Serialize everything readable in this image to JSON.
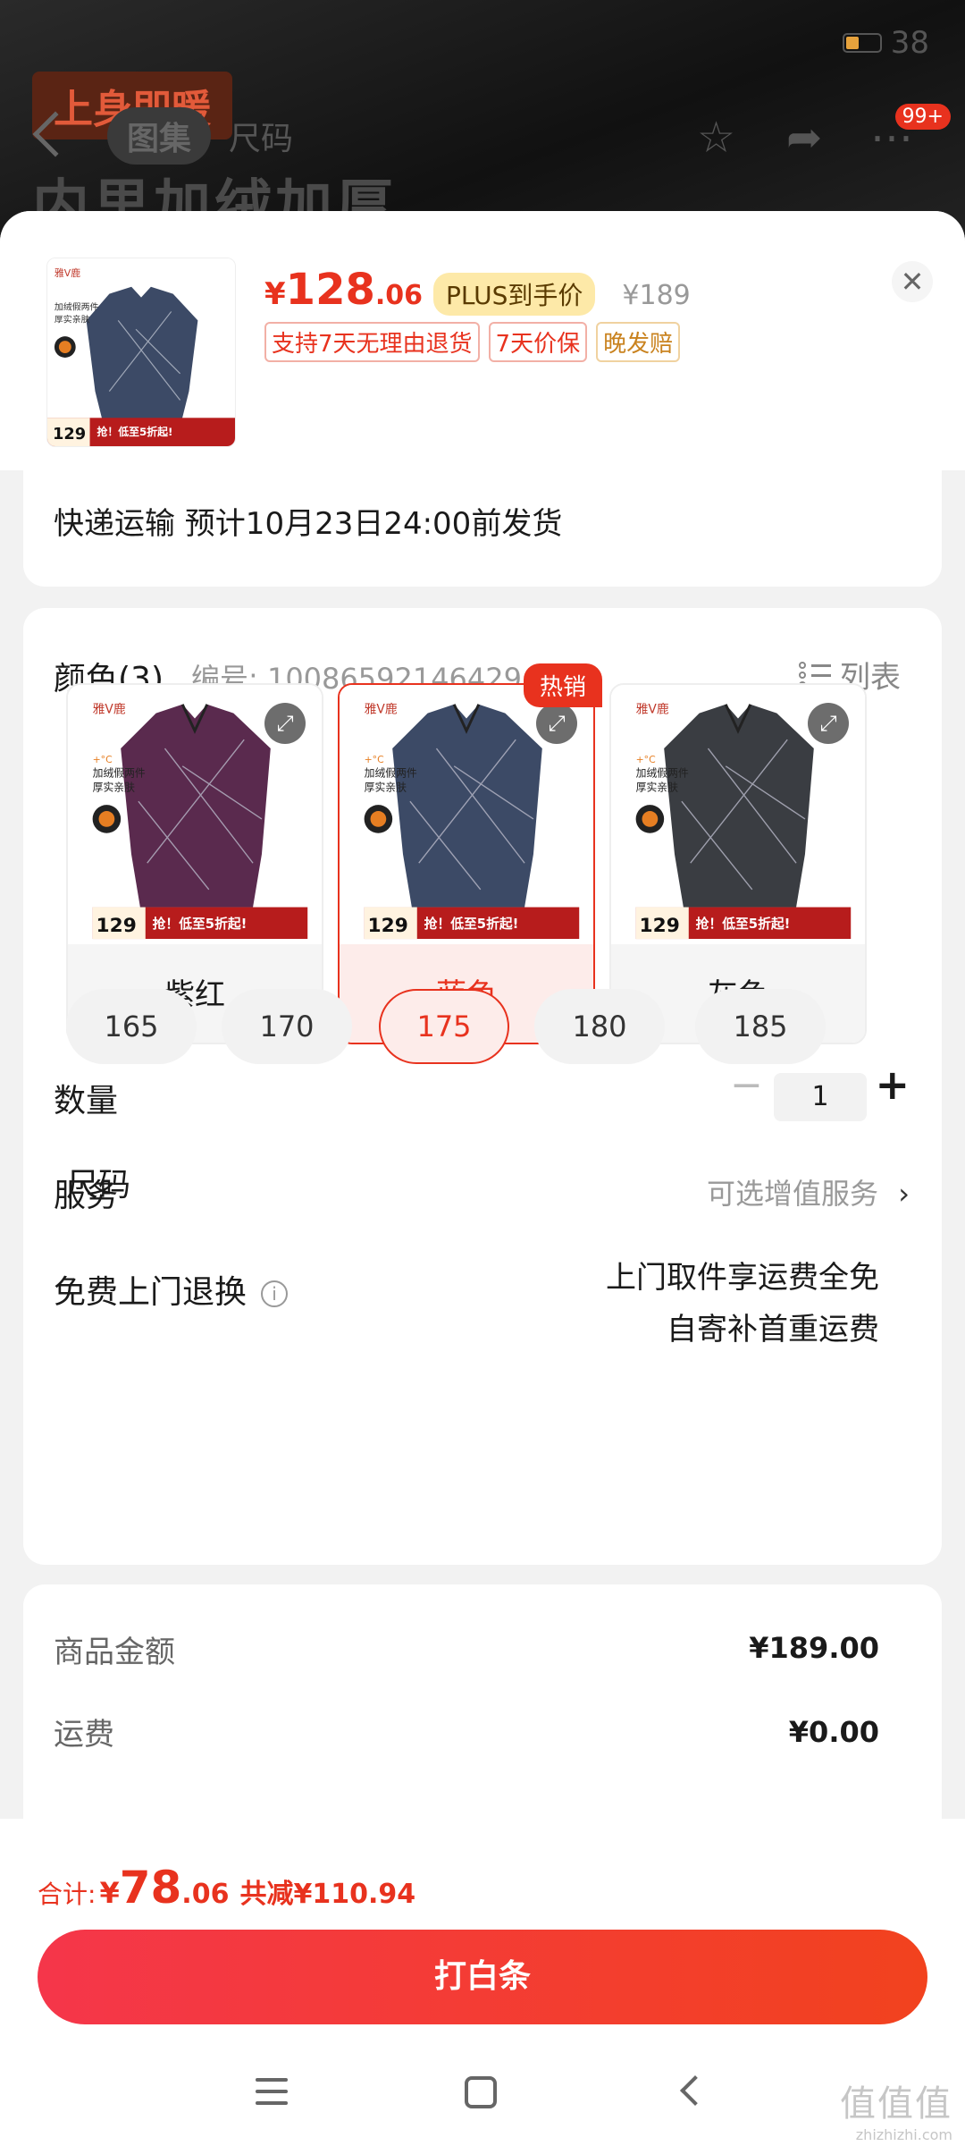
{
  "background": {
    "promo_text": "上身即暖",
    "headline": "内里加绒加厚",
    "status_battery": "38",
    "tabs": [
      {
        "label": "图集"
      },
      {
        "label": "尺码"
      }
    ],
    "cart_badge": "99+"
  },
  "header": {
    "price_symbol": "¥",
    "price_int": "128",
    "price_dec": ".06",
    "plus_tag": "PLUS到手价",
    "original_price": "¥189",
    "tags": [
      {
        "label": "支持7天无理由退货"
      },
      {
        "label": "7天价保"
      },
      {
        "label": "晚发赔"
      }
    ],
    "thumb": {
      "brand": "雅V鹿",
      "line1": "加绒假两件",
      "line2": "厚实亲肤",
      "price": "129",
      "banner": "抢！低至5折起!"
    }
  },
  "delivery": {
    "text": "快递运输 预计10月23日24:00前发货"
  },
  "color_section": {
    "title": "颜色(3)",
    "sku_number": "编号: 10086592146429",
    "list_toggle": "列表",
    "hot_badge": "热销",
    "options": [
      {
        "label": "紫红",
        "color": "#5a2a4e",
        "selected": false
      },
      {
        "label": "蓝色",
        "color": "#3c4a66",
        "selected": true
      },
      {
        "label": "灰色",
        "color": "#3a3d42",
        "selected": false
      }
    ],
    "image_text": {
      "brand": "雅V鹿",
      "temp": "+°C",
      "line1": "加绒假两件",
      "line2": "厚实亲肤",
      "price": "129",
      "banner": "抢！低至5折起!"
    }
  },
  "size_section": {
    "title": "尺码",
    "options": [
      {
        "label": "165",
        "selected": false
      },
      {
        "label": "170",
        "selected": false
      },
      {
        "label": "175",
        "selected": true
      },
      {
        "label": "180",
        "selected": false
      },
      {
        "label": "185",
        "selected": false
      }
    ]
  },
  "quantity": {
    "label": "数量",
    "minus": "−",
    "value": "1",
    "plus": "+"
  },
  "service": {
    "label": "服务",
    "value": "可选增值服务",
    "chevron": "›"
  },
  "return": {
    "label": "免费上门退换",
    "info_icon": "i",
    "line1": "上门取件享运费全免",
    "line2": "自寄补首重运费"
  },
  "cost": {
    "items": [
      {
        "label": "商品金额",
        "value": "¥189.00"
      },
      {
        "label": "运费",
        "value": "¥0.00"
      }
    ]
  },
  "footer": {
    "total_label": "合计:",
    "total_symbol": "¥",
    "total_int": "78",
    "total_dec": ".06",
    "total_saving": "共减¥110.94",
    "pay_button": "打白条"
  },
  "watermark": {
    "line1": "值值值",
    "line2": "zhizhizhi.com"
  },
  "colors": {
    "accent": "#e8321e",
    "plus_bg": "#fde9a8",
    "selected_bg": "#fdecea"
  }
}
